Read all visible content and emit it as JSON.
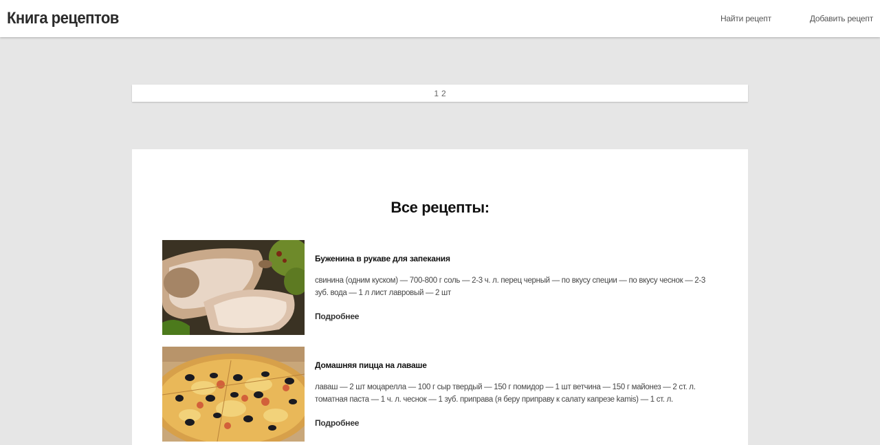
{
  "header": {
    "brand": "Книга рецептов",
    "nav": [
      {
        "label": "Найти рецепт"
      },
      {
        "label": "Добавить рецепт"
      }
    ]
  },
  "pagination": {
    "pages": [
      "1",
      "2"
    ]
  },
  "main": {
    "title": "Все рецепты:",
    "recipes": [
      {
        "title": "Буженина в рукаве для запекания",
        "ingredients": "свинина (одним куском) — 700-800 г соль — 2-3 ч. л. перец черный — по вкусу специи — по вкусу чеснок — 2-3 зуб. вода — 1 л лист лавровый — 2 шт",
        "more_label": "Подробнее"
      },
      {
        "title": "Домашняя пицца на лаваше",
        "ingredients": "лаваш — 2 шт моцарелла — 100 г сыр твердый — 150 г помидор — 1 шт ветчина — 150 г майонез — 2 ст. л. томатная паста — 1 ч. л. чеснок — 1 зуб. приправа (я беру приправу к салату капрезе kamis) — 1 ст. л.",
        "more_label": "Подробнее"
      }
    ]
  }
}
